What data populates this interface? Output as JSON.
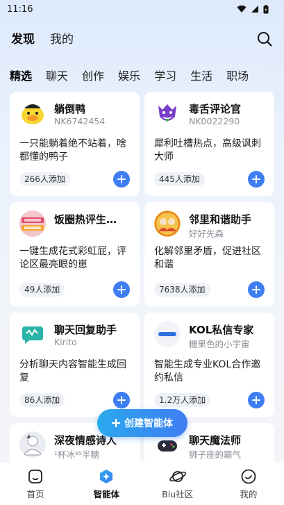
{
  "status_bar": {
    "time": "11:16"
  },
  "header": {
    "tabs": [
      {
        "label": "发现",
        "active": true
      },
      {
        "label": "我的",
        "active": false
      }
    ]
  },
  "categories": [
    "精选",
    "聊天",
    "创作",
    "娱乐",
    "学习",
    "生活",
    "职场"
  ],
  "cards": [
    {
      "name": "躺倒鸭",
      "sub": "NK6742454",
      "desc": "一只能躺着绝不站着，啥都懂的鸭子",
      "count": "266人添加",
      "icon": "duck-avatar"
    },
    {
      "name": "毒舌评论官",
      "sub": "NK0022290",
      "desc": "犀利吐槽热点，高级讽刺大师",
      "count": "445人添加",
      "icon": "purple-monster-avatar"
    },
    {
      "name": "饭圈热评生…",
      "sub": "",
      "desc": "一键生成花式彩虹屁，评论区最亮眼的崽",
      "count": "49人添加",
      "icon": "fan-banner-avatar"
    },
    {
      "name": "邻里和谐助手",
      "sub": "好好先森",
      "desc": "化解邻里矛盾，促进社区和谐",
      "count": "7638人添加",
      "icon": "neighbors-avatar"
    },
    {
      "name": "聊天回复助手",
      "sub": "Kirito",
      "desc": "分析聊天内容智能生成回复",
      "count": "86人添加",
      "icon": "chat-bubble-avatar"
    },
    {
      "name": "KOL私信专家",
      "sub": "糖果色的小宇宙",
      "desc": "智能生成专业KOL合作邀约私信",
      "count": "1.2万人添加",
      "icon": "kol-logo-avatar"
    },
    {
      "name": "深夜情感诗人",
      "sub": "¹杯冰⁸⁵半糖",
      "desc": "",
      "count": "",
      "icon": "poet-avatar"
    },
    {
      "name": "聊天魔法师",
      "sub": "狮子座的霸气",
      "desc": "",
      "count": "",
      "icon": "game-controller-avatar"
    }
  ],
  "create_button": {
    "label": "创建智能体"
  },
  "bottom_nav": [
    {
      "label": "首页",
      "icon": "home-icon",
      "active": false
    },
    {
      "label": "智能体",
      "icon": "agent-icon",
      "active": true
    },
    {
      "label": "Biu社区",
      "icon": "planet-icon",
      "active": false
    },
    {
      "label": "我的",
      "icon": "smile-icon",
      "active": false
    }
  ],
  "colors": {
    "accent": "#3f7df2",
    "background": "#e8f1fd"
  }
}
